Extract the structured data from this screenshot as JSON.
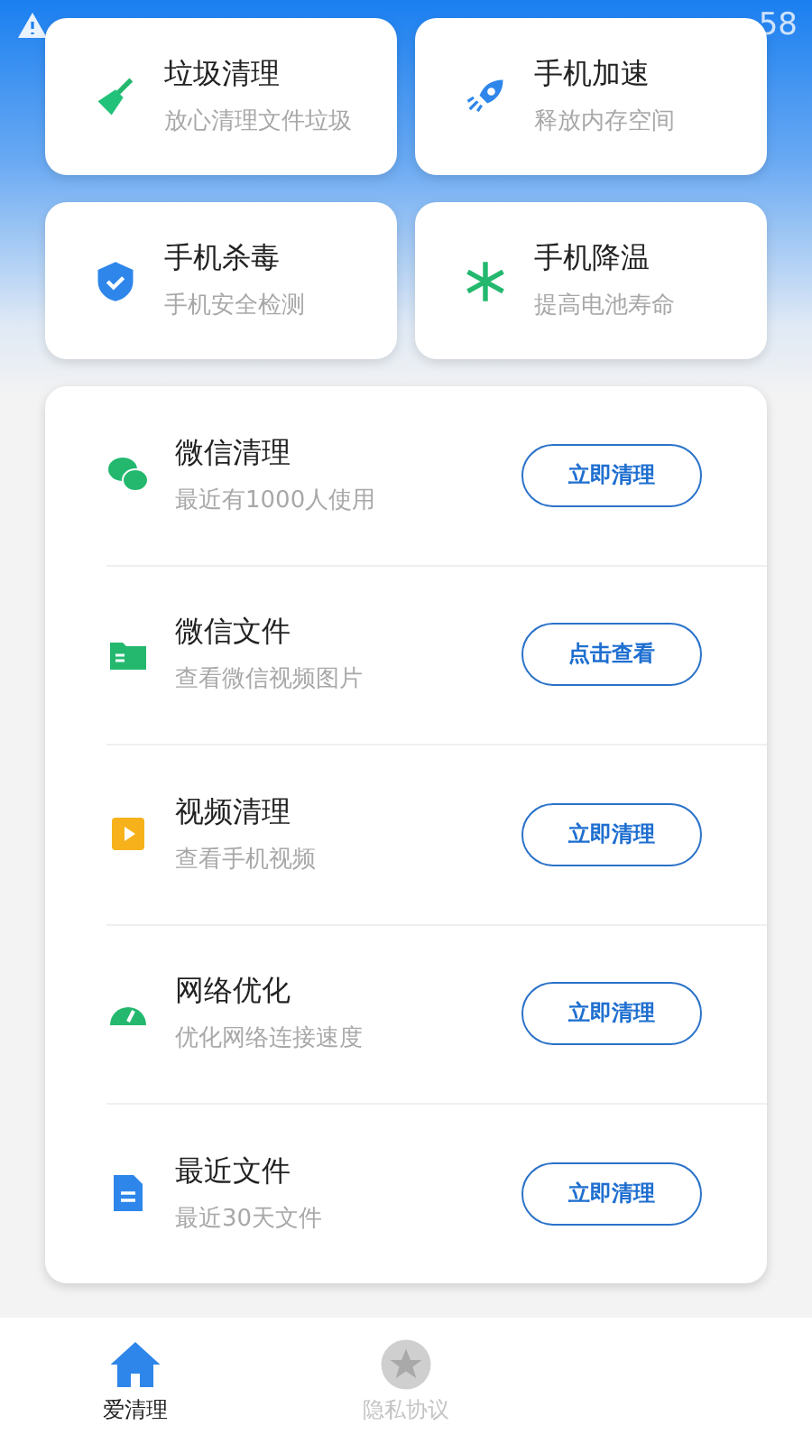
{
  "status_bar": {
    "time": "58"
  },
  "tiles": [
    {
      "kind": "broom",
      "title": "垃圾清理",
      "subtitle": "放心清理文件垃圾"
    },
    {
      "kind": "rocket",
      "title": "手机加速",
      "subtitle": "释放内存空间"
    },
    {
      "kind": "shield",
      "title": "手机杀毒",
      "subtitle": "手机安全检测"
    },
    {
      "kind": "snowflake",
      "title": "手机降温",
      "subtitle": "提高电池寿命"
    }
  ],
  "list": [
    {
      "kind": "chat",
      "title": "微信清理",
      "subtitle": "最近有1000人使用",
      "button": "立即清理"
    },
    {
      "kind": "folder",
      "title": "微信文件",
      "subtitle": "查看微信视频图片",
      "button": "点击查看"
    },
    {
      "kind": "video",
      "title": "视频清理",
      "subtitle": "查看手机视频",
      "button": "立即清理"
    },
    {
      "kind": "gauge",
      "title": "网络优化",
      "subtitle": "优化网络连接速度",
      "button": "立即清理"
    },
    {
      "kind": "document",
      "title": "最近文件",
      "subtitle": "最近30天文件",
      "button": "立即清理"
    }
  ],
  "nav": [
    {
      "kind": "home",
      "label": "爱清理",
      "selected": true
    },
    {
      "kind": "star",
      "label": "隐私协议",
      "selected": false
    }
  ]
}
